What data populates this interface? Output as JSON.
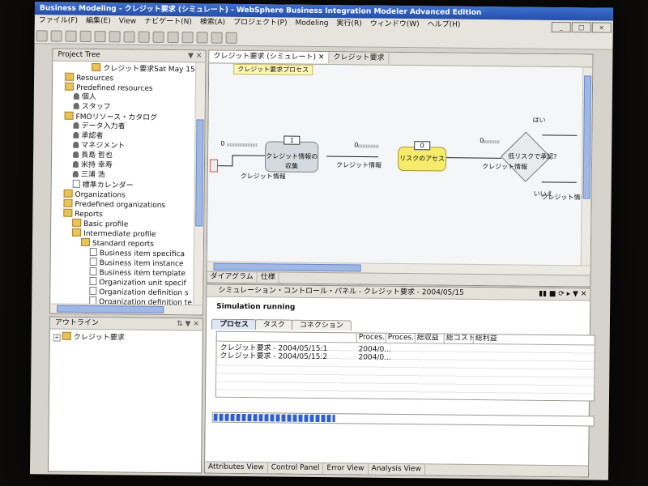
{
  "window": {
    "title": "Business Modeling - クレジット要求 (シミュレート) - WebSphere Business Integration Modeler Advanced Edition"
  },
  "menu": [
    "ファイル(F)",
    "編集(E)",
    "View",
    "ナビゲート(N)",
    "検索(A)",
    "プロジェクト(P)",
    "Modeling",
    "実行(R)",
    "ウィンドウ(W)",
    "ヘルプ(H)"
  ],
  "project_tree": {
    "title": "Project Tree",
    "items": [
      {
        "label": "クレジット要求Sat May 15",
        "icon": "process-icon",
        "indent": 4
      },
      {
        "label": "Resources",
        "icon": "folder-icon",
        "indent": 1
      },
      {
        "label": "Predefined resources",
        "icon": "folder-icon",
        "indent": 1
      },
      {
        "label": "個人",
        "icon": "resource-icon",
        "indent": 2
      },
      {
        "label": "スタッフ",
        "icon": "resource-icon",
        "indent": 2
      },
      {
        "label": "FMOリソース・カタログ",
        "icon": "folder-icon",
        "indent": 1
      },
      {
        "label": "データ入力者",
        "icon": "person-icon",
        "indent": 2
      },
      {
        "label": "承認者",
        "icon": "person-icon",
        "indent": 2
      },
      {
        "label": "マネジメント",
        "icon": "person-icon",
        "indent": 2
      },
      {
        "label": "長島 哲也",
        "icon": "person-icon",
        "indent": 2
      },
      {
        "label": "米持 幸寿",
        "icon": "person-icon",
        "indent": 2
      },
      {
        "label": "三浦 浩",
        "icon": "person-icon",
        "indent": 2
      },
      {
        "label": "標準カレンダー",
        "icon": "calendar-icon",
        "indent": 2
      },
      {
        "label": "Organizations",
        "icon": "folder-icon",
        "indent": 1
      },
      {
        "label": "Predefined organizations",
        "icon": "folder-icon",
        "indent": 1
      },
      {
        "label": "Reports",
        "icon": "folder-icon",
        "indent": 1
      },
      {
        "label": "Basic profile",
        "icon": "folder-icon",
        "indent": 2
      },
      {
        "label": "Intermediate profile",
        "icon": "folder-icon",
        "indent": 2
      },
      {
        "label": "Standard reports",
        "icon": "folder-icon",
        "indent": 3
      },
      {
        "label": "Business item specifica",
        "icon": "doc-icon",
        "indent": 4
      },
      {
        "label": "Business item instance",
        "icon": "doc-icon",
        "indent": 4
      },
      {
        "label": "Business item template",
        "icon": "doc-icon",
        "indent": 4
      },
      {
        "label": "Organization unit specif",
        "icon": "doc-icon",
        "indent": 4
      },
      {
        "label": "Organization definition s",
        "icon": "doc-icon",
        "indent": 4
      },
      {
        "label": "Organization definition te",
        "icon": "doc-icon",
        "indent": 4
      }
    ]
  },
  "outline": {
    "title": "アウトライン",
    "item": "クレジット要求"
  },
  "editor": {
    "tabs": [
      "クレジット要求 (シミュレート)",
      "クレジット要求"
    ],
    "process_label": "クレジット要求プロセス",
    "bottom_tabs": [
      "ダイアグラム",
      "仕様"
    ],
    "diagram": {
      "task1": "クレジット情報の収集",
      "task1_count": "1",
      "task2": "リスクのアセス",
      "task2_count": "0",
      "decision": "低リスクで承認?",
      "yes": "はい",
      "no": "いいえ",
      "data_label": "クレジット情報",
      "counter": "0"
    }
  },
  "simulation": {
    "title": "シミュレーション・コントロール・パネル - クレジット要求 - 2004/05/15",
    "status": "Simulation running",
    "tabs": [
      "プロセス",
      "タスク",
      "コネクション"
    ],
    "columns": [
      "",
      "Proces...",
      "Proces...",
      "総収益",
      "総コスト",
      "総利益"
    ],
    "rows": [
      {
        "name": "クレジット要求 - 2004/05/15:1",
        "date": "2004/0..."
      },
      {
        "name": "クレジット要求 - 2004/05/15:2",
        "date": "2004/0..."
      }
    ],
    "progress": 0.32,
    "bottom_tabs": [
      "Attributes View",
      "Control Panel",
      "Error View",
      "Analysis View"
    ]
  }
}
